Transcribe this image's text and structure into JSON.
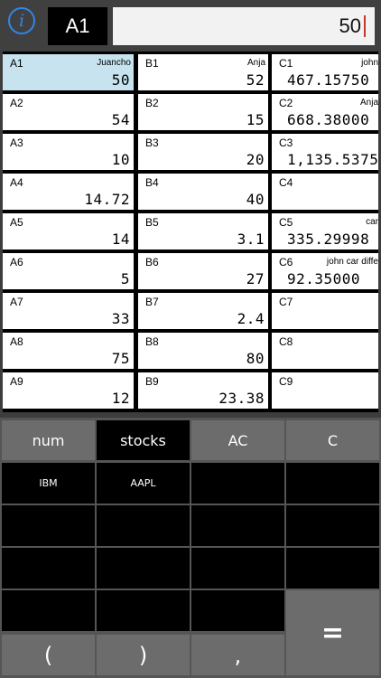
{
  "toolbar": {
    "info_glyph": "i",
    "cell_ref": "A1",
    "formula_value": "50"
  },
  "grid": {
    "rows": [
      [
        {
          "addr": "A1",
          "note": "Juancho",
          "val": "50"
        },
        {
          "addr": "B1",
          "note": "Anja",
          "val": "52"
        },
        {
          "addr": "C1",
          "note": "john",
          "val": "467.15750"
        }
      ],
      [
        {
          "addr": "A2",
          "note": "",
          "val": "54"
        },
        {
          "addr": "B2",
          "note": "",
          "val": "15"
        },
        {
          "addr": "C2",
          "note": "Anja",
          "val": "668.38000"
        }
      ],
      [
        {
          "addr": "A3",
          "note": "",
          "val": "10"
        },
        {
          "addr": "B3",
          "note": "",
          "val": "20"
        },
        {
          "addr": "C3",
          "note": "",
          "val": "1,135.53750"
        }
      ],
      [
        {
          "addr": "A4",
          "note": "",
          "val": "14.72"
        },
        {
          "addr": "B4",
          "note": "",
          "val": "40"
        },
        {
          "addr": "C4",
          "note": "",
          "val": ""
        }
      ],
      [
        {
          "addr": "A5",
          "note": "",
          "val": "14"
        },
        {
          "addr": "B5",
          "note": "",
          "val": "3.1"
        },
        {
          "addr": "C5",
          "note": "car",
          "val": "335.29998"
        }
      ],
      [
        {
          "addr": "A6",
          "note": "",
          "val": "5"
        },
        {
          "addr": "B6",
          "note": "",
          "val": "27"
        },
        {
          "addr": "C6",
          "note": "john car diffe",
          "val": "92.35000"
        }
      ],
      [
        {
          "addr": "A7",
          "note": "",
          "val": "33"
        },
        {
          "addr": "B7",
          "note": "",
          "val": "2.4"
        },
        {
          "addr": "C7",
          "note": "",
          "val": ""
        }
      ],
      [
        {
          "addr": "A8",
          "note": "",
          "val": "75"
        },
        {
          "addr": "B8",
          "note": "",
          "val": "80"
        },
        {
          "addr": "C8",
          "note": "",
          "val": ""
        }
      ],
      [
        {
          "addr": "A9",
          "note": "",
          "val": "12"
        },
        {
          "addr": "B9",
          "note": "",
          "val": "23.38"
        },
        {
          "addr": "C9",
          "note": "",
          "val": ""
        }
      ]
    ]
  },
  "keypad": {
    "tabs": [
      "num",
      "stocks",
      "AC",
      "C"
    ],
    "active_tab": "stocks",
    "stock_keys": [
      "IBM",
      "AAPL"
    ],
    "bottom_keys": [
      "(",
      ")",
      ","
    ],
    "equals": "="
  }
}
